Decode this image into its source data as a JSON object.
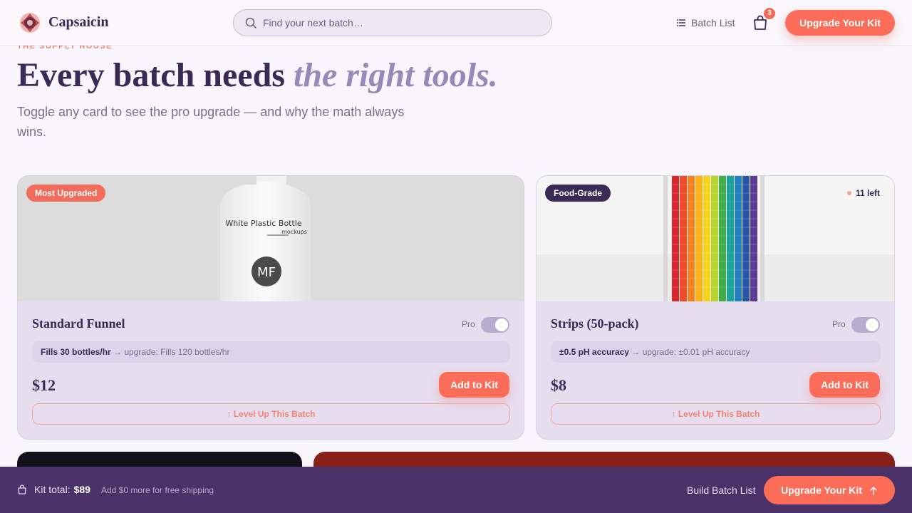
{
  "header": {
    "brand": "Capsaicin",
    "search_placeholder": "Find your next batch…",
    "batch_list_label": "Batch List",
    "cart_count": "3",
    "upgrade_label": "Upgrade Your Kit"
  },
  "hero": {
    "eyebrow": "THE SUPPLY HOUSE",
    "title_main": "Every batch needs ",
    "title_accent": "the right tools.",
    "subtitle": "Toggle any card to see the pro upgrade — and why the math always wins."
  },
  "cards": [
    {
      "tag": "Most Upgraded",
      "image_label": "White Plastic Bottle",
      "image_sub": "mockups",
      "image_mark": "MF",
      "name": "Standard Funnel",
      "pro_label": "Pro",
      "spec_current": "Fills 30 bottles/hr",
      "spec_upgrade": "→ upgrade: Fills 120 bottles/hr",
      "price": "$12",
      "add_label": "Add to Kit",
      "level_label": "↑ Level Up This Batch"
    },
    {
      "tag": "Food-Grade",
      "stock": "11 left",
      "name": "Strips (50-pack)",
      "pro_label": "Pro",
      "spec_current": "±0.5 pH accuracy",
      "spec_upgrade": "→ upgrade: ±0.01 pH accuracy",
      "price": "$8",
      "add_label": "Add to Kit",
      "level_label": "↑ Level Up This Batch"
    }
  ],
  "bottombar": {
    "kit_total_label": "Kit total:",
    "kit_total_value": "$89",
    "shipping_note": "Add $0 more for free shipping",
    "build_label": "Build Batch List",
    "upgrade_label": "Upgrade Your Kit"
  },
  "colors": {
    "accent": "#fb6d58",
    "brand_dark": "#3a2a55",
    "muted_purple": "#978ab8",
    "bottom_bar": "#4a3168"
  }
}
